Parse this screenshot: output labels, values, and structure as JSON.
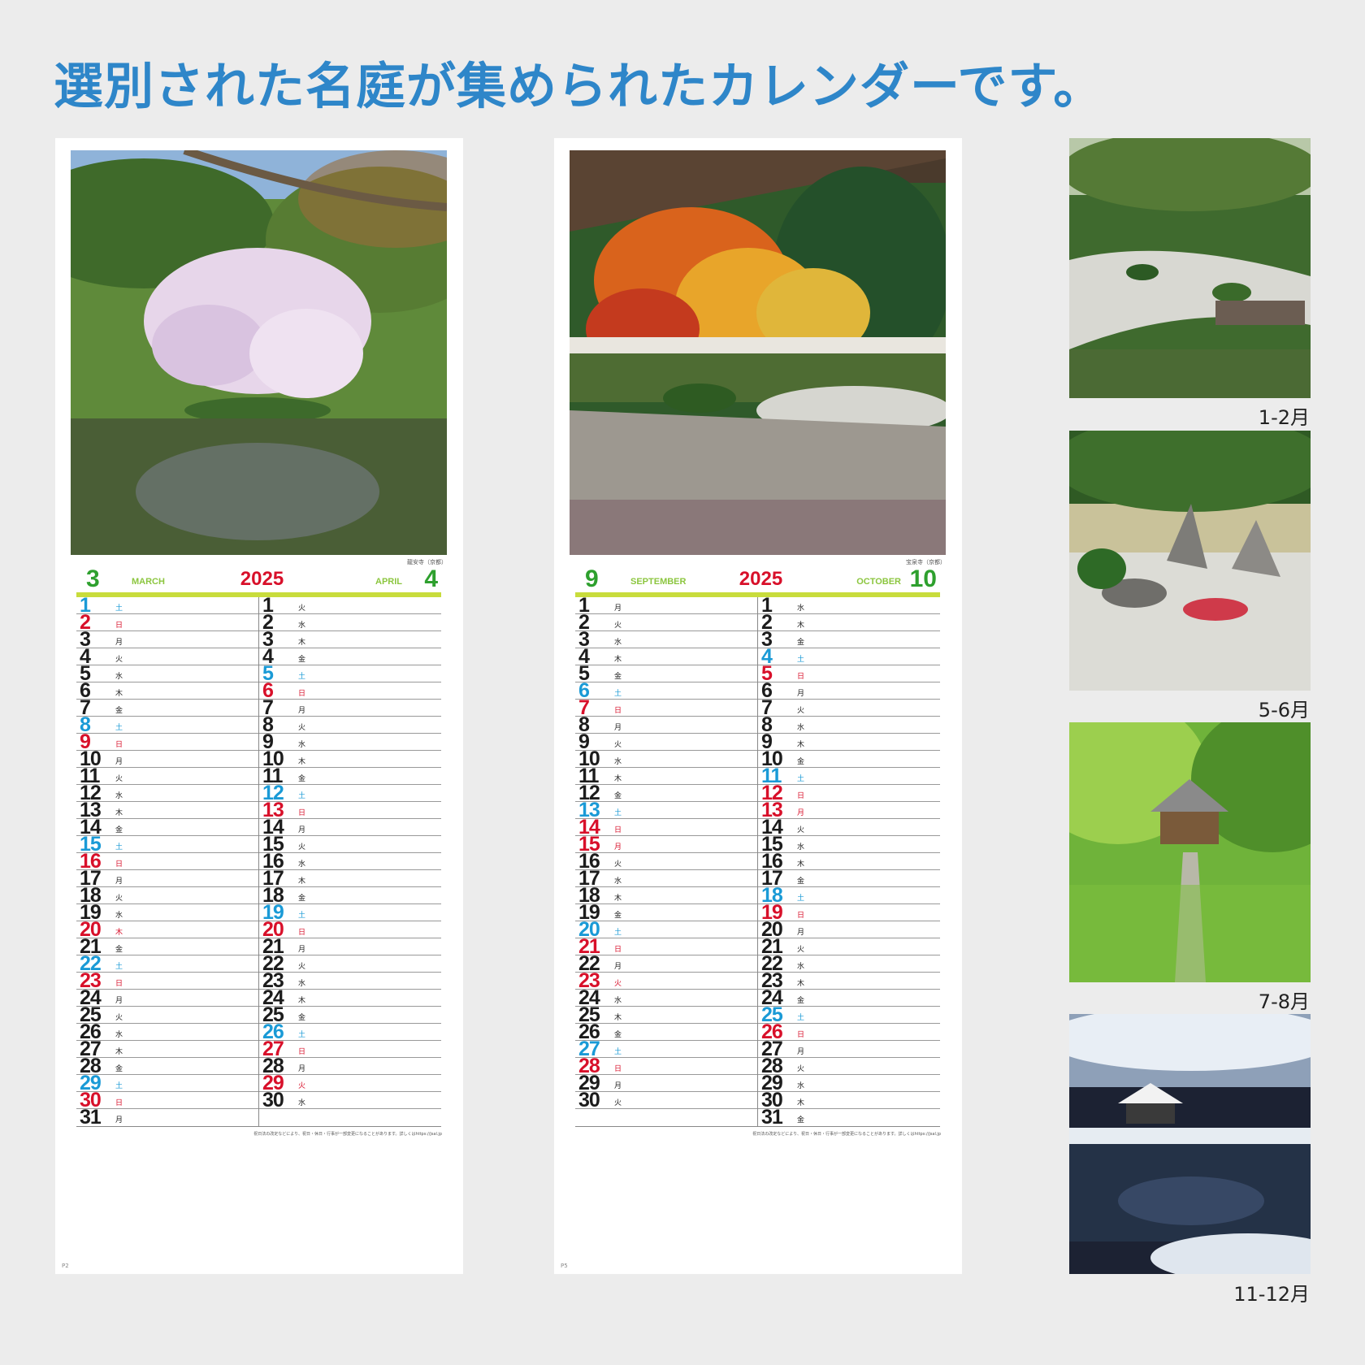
{
  "headline": "選別された名庭が集められたカレンダーです。",
  "pages": [
    {
      "caption": "龍安寺（京都）",
      "page_label": "P2",
      "year": "2025",
      "left_month": {
        "num": "3",
        "name": "MARCH"
      },
      "right_month": {
        "num": "4",
        "name": "APRIL"
      },
      "footer": "祝日法の改定などにより、祝日・休日・行事が一部変更になることがあります。詳しくはhttps://jsal.jp",
      "left_days": [
        {
          "d": "1",
          "w": "土",
          "t": "sat"
        },
        {
          "d": "2",
          "w": "日",
          "t": "sun"
        },
        {
          "d": "3",
          "w": "月"
        },
        {
          "d": "4",
          "w": "火"
        },
        {
          "d": "5",
          "w": "水"
        },
        {
          "d": "6",
          "w": "木"
        },
        {
          "d": "7",
          "w": "金"
        },
        {
          "d": "8",
          "w": "土",
          "t": "sat"
        },
        {
          "d": "9",
          "w": "日",
          "t": "sun"
        },
        {
          "d": "10",
          "w": "月"
        },
        {
          "d": "11",
          "w": "火"
        },
        {
          "d": "12",
          "w": "水"
        },
        {
          "d": "13",
          "w": "木"
        },
        {
          "d": "14",
          "w": "金"
        },
        {
          "d": "15",
          "w": "土",
          "t": "sat"
        },
        {
          "d": "16",
          "w": "日",
          "t": "sun"
        },
        {
          "d": "17",
          "w": "月"
        },
        {
          "d": "18",
          "w": "火"
        },
        {
          "d": "19",
          "w": "水"
        },
        {
          "d": "20",
          "w": "木",
          "t": "hol"
        },
        {
          "d": "21",
          "w": "金"
        },
        {
          "d": "22",
          "w": "土",
          "t": "sat"
        },
        {
          "d": "23",
          "w": "日",
          "t": "sun"
        },
        {
          "d": "24",
          "w": "月"
        },
        {
          "d": "25",
          "w": "火"
        },
        {
          "d": "26",
          "w": "水"
        },
        {
          "d": "27",
          "w": "木"
        },
        {
          "d": "28",
          "w": "金"
        },
        {
          "d": "29",
          "w": "土",
          "t": "sat"
        },
        {
          "d": "30",
          "w": "日",
          "t": "sun"
        },
        {
          "d": "31",
          "w": "月"
        }
      ],
      "right_days": [
        {
          "d": "1",
          "w": "火"
        },
        {
          "d": "2",
          "w": "水"
        },
        {
          "d": "3",
          "w": "木"
        },
        {
          "d": "4",
          "w": "金"
        },
        {
          "d": "5",
          "w": "土",
          "t": "sat"
        },
        {
          "d": "6",
          "w": "日",
          "t": "sun"
        },
        {
          "d": "7",
          "w": "月"
        },
        {
          "d": "8",
          "w": "火"
        },
        {
          "d": "9",
          "w": "水"
        },
        {
          "d": "10",
          "w": "木"
        },
        {
          "d": "11",
          "w": "金"
        },
        {
          "d": "12",
          "w": "土",
          "t": "sat"
        },
        {
          "d": "13",
          "w": "日",
          "t": "sun"
        },
        {
          "d": "14",
          "w": "月"
        },
        {
          "d": "15",
          "w": "火"
        },
        {
          "d": "16",
          "w": "水"
        },
        {
          "d": "17",
          "w": "木"
        },
        {
          "d": "18",
          "w": "金"
        },
        {
          "d": "19",
          "w": "土",
          "t": "sat"
        },
        {
          "d": "20",
          "w": "日",
          "t": "sun"
        },
        {
          "d": "21",
          "w": "月"
        },
        {
          "d": "22",
          "w": "火"
        },
        {
          "d": "23",
          "w": "水"
        },
        {
          "d": "24",
          "w": "木"
        },
        {
          "d": "25",
          "w": "金"
        },
        {
          "d": "26",
          "w": "土",
          "t": "sat"
        },
        {
          "d": "27",
          "w": "日",
          "t": "sun"
        },
        {
          "d": "28",
          "w": "月"
        },
        {
          "d": "29",
          "w": "火",
          "t": "hol"
        },
        {
          "d": "30",
          "w": "水"
        }
      ]
    },
    {
      "caption": "宝泉寺（京都）",
      "page_label": "P5",
      "year": "2025",
      "left_month": {
        "num": "9",
        "name": "SEPTEMBER"
      },
      "right_month": {
        "num": "10",
        "name": "OCTOBER"
      },
      "footer": "祝日法の改定などにより、祝日・休日・行事が一部変更になることがあります。詳しくはhttps://jsal.jp",
      "left_days": [
        {
          "d": "1",
          "w": "月"
        },
        {
          "d": "2",
          "w": "火"
        },
        {
          "d": "3",
          "w": "水"
        },
        {
          "d": "4",
          "w": "木"
        },
        {
          "d": "5",
          "w": "金"
        },
        {
          "d": "6",
          "w": "土",
          "t": "sat"
        },
        {
          "d": "7",
          "w": "日",
          "t": "sun"
        },
        {
          "d": "8",
          "w": "月"
        },
        {
          "d": "9",
          "w": "火"
        },
        {
          "d": "10",
          "w": "水"
        },
        {
          "d": "11",
          "w": "木"
        },
        {
          "d": "12",
          "w": "金"
        },
        {
          "d": "13",
          "w": "土",
          "t": "sat"
        },
        {
          "d": "14",
          "w": "日",
          "t": "sun"
        },
        {
          "d": "15",
          "w": "月",
          "t": "hol"
        },
        {
          "d": "16",
          "w": "火"
        },
        {
          "d": "17",
          "w": "水"
        },
        {
          "d": "18",
          "w": "木"
        },
        {
          "d": "19",
          "w": "金"
        },
        {
          "d": "20",
          "w": "土",
          "t": "sat"
        },
        {
          "d": "21",
          "w": "日",
          "t": "sun"
        },
        {
          "d": "22",
          "w": "月"
        },
        {
          "d": "23",
          "w": "火",
          "t": "hol"
        },
        {
          "d": "24",
          "w": "水"
        },
        {
          "d": "25",
          "w": "木"
        },
        {
          "d": "26",
          "w": "金"
        },
        {
          "d": "27",
          "w": "土",
          "t": "sat"
        },
        {
          "d": "28",
          "w": "日",
          "t": "sun"
        },
        {
          "d": "29",
          "w": "月"
        },
        {
          "d": "30",
          "w": "火"
        }
      ],
      "right_days": [
        {
          "d": "1",
          "w": "水"
        },
        {
          "d": "2",
          "w": "木"
        },
        {
          "d": "3",
          "w": "金"
        },
        {
          "d": "4",
          "w": "土",
          "t": "sat"
        },
        {
          "d": "5",
          "w": "日",
          "t": "sun"
        },
        {
          "d": "6",
          "w": "月"
        },
        {
          "d": "7",
          "w": "火"
        },
        {
          "d": "8",
          "w": "水"
        },
        {
          "d": "9",
          "w": "木"
        },
        {
          "d": "10",
          "w": "金"
        },
        {
          "d": "11",
          "w": "土",
          "t": "sat"
        },
        {
          "d": "12",
          "w": "日",
          "t": "sun"
        },
        {
          "d": "13",
          "w": "月",
          "t": "hol"
        },
        {
          "d": "14",
          "w": "火"
        },
        {
          "d": "15",
          "w": "水"
        },
        {
          "d": "16",
          "w": "木"
        },
        {
          "d": "17",
          "w": "金"
        },
        {
          "d": "18",
          "w": "土",
          "t": "sat"
        },
        {
          "d": "19",
          "w": "日",
          "t": "sun"
        },
        {
          "d": "20",
          "w": "月"
        },
        {
          "d": "21",
          "w": "火"
        },
        {
          "d": "22",
          "w": "水"
        },
        {
          "d": "23",
          "w": "木"
        },
        {
          "d": "24",
          "w": "金"
        },
        {
          "d": "25",
          "w": "土",
          "t": "sat"
        },
        {
          "d": "26",
          "w": "日",
          "t": "sun"
        },
        {
          "d": "27",
          "w": "月"
        },
        {
          "d": "28",
          "w": "火"
        },
        {
          "d": "29",
          "w": "水"
        },
        {
          "d": "30",
          "w": "木"
        },
        {
          "d": "31",
          "w": "金"
        }
      ]
    }
  ],
  "thumbnails": [
    {
      "label": "1-2月"
    },
    {
      "label": "5-6月"
    },
    {
      "label": "7-8月"
    },
    {
      "label": "11-12月"
    }
  ],
  "colors": {
    "headline": "#2e86c9",
    "saturday": "#1a9ad6",
    "sunday": "#d8102a",
    "month_green": "#2ea02e",
    "year_red": "#d8102a",
    "header_bar": "#c8dc3c"
  }
}
